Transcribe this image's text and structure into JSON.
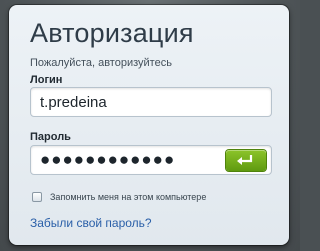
{
  "login_form": {
    "title": "Авторизация",
    "subtitle": "Пожалуйста, авторизуйтесь",
    "login_label": "Логин",
    "login_value": "t.predeina",
    "password_label": "Пароль",
    "password_value": "●●●●●●●●●●●●",
    "submit_icon": "enter-return-icon",
    "remember_label": "Запомнить меня на этом компьютере",
    "remember_checked": false,
    "forgot_link": "Забыли свой пароль?",
    "colors": {
      "accent_green": "#6faa17",
      "link_blue": "#2a5fa8",
      "title_text": "#2f3c48"
    }
  }
}
